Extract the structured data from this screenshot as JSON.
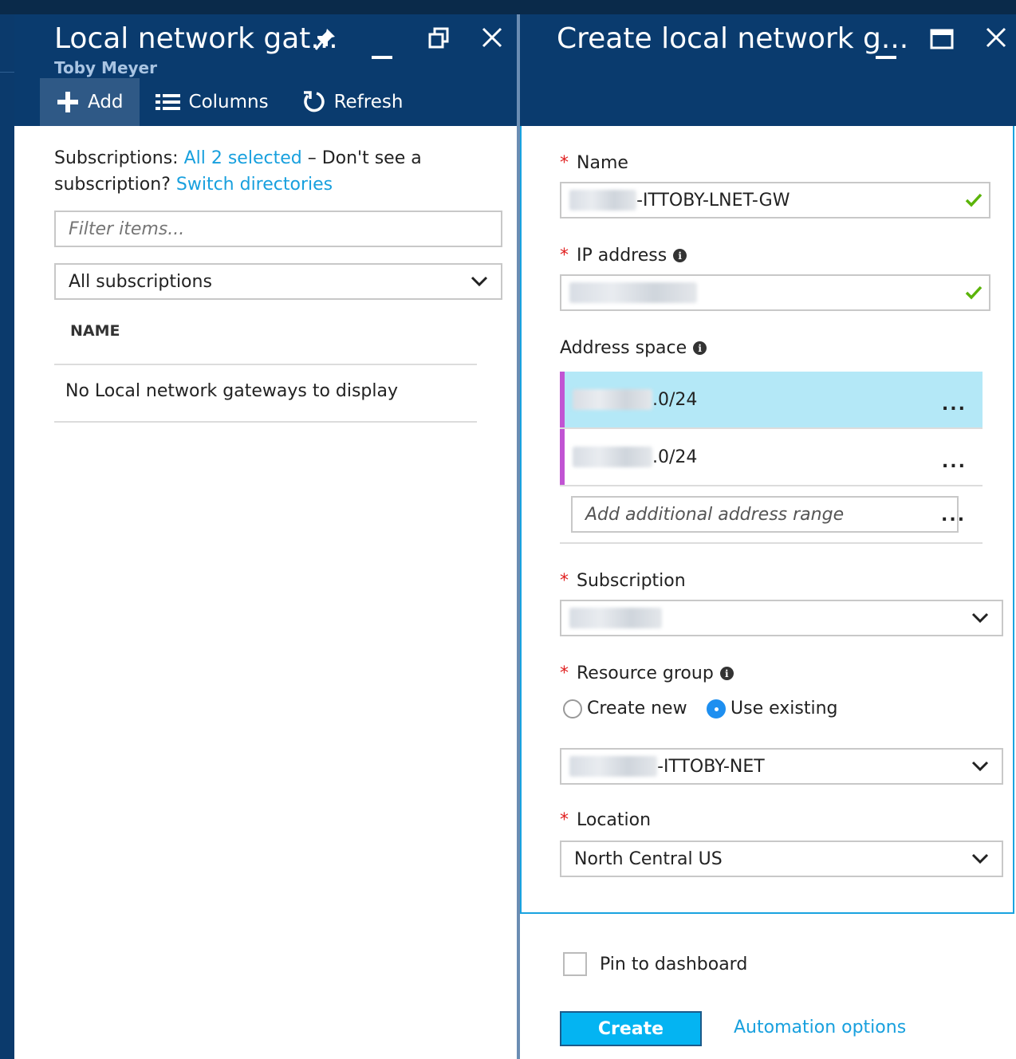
{
  "left_blade": {
    "title": "Local network gat...",
    "subtitle": "Toby Meyer",
    "toolbar": {
      "add": "Add",
      "columns": "Columns",
      "refresh": "Refresh"
    },
    "subscriptions_label": "Subscriptions:",
    "subscriptions_link": "All 2 selected",
    "subscriptions_dash": " – Don't see a subscription? ",
    "switch_link": "Switch directories",
    "filter_placeholder": "Filter items...",
    "subscription_select": "All subscriptions",
    "column_name": "NAME",
    "empty_message": "No Local network gateways to display"
  },
  "right_blade": {
    "title": "Create local network g...",
    "name_label": "Name",
    "name_value_suffix": "-ITTOBY-LNET-GW",
    "ip_label": "IP address",
    "address_space_label": "Address space",
    "address_ranges": [
      {
        "suffix": ".0/24"
      },
      {
        "suffix": ".0/24"
      }
    ],
    "add_range_placeholder": "Add additional address range",
    "subscription_label": "Subscription",
    "resource_group_label": "Resource group",
    "radio_create_new": "Create new",
    "radio_use_existing": "Use existing",
    "resource_group_value_suffix": "-ITTOBY-NET",
    "location_label": "Location",
    "location_value": "North Central US",
    "pin_label": "Pin to dashboard",
    "create_button": "Create",
    "automation_link": "Automation options"
  },
  "icons": {
    "pin": "pin-icon",
    "minimize": "minimize-icon",
    "restore": "restore-icon",
    "maximize": "maximize-icon",
    "close": "close-icon",
    "add": "plus-icon",
    "columns": "columns-icon",
    "refresh": "refresh-icon",
    "check": "check-icon",
    "chevron": "chevron-down-icon",
    "info": "info-icon",
    "more": "more-icon"
  },
  "colors": {
    "header": "#0a3b6e",
    "link": "#18a0de",
    "accent_border": "#19a3e0",
    "selected_row": "#b4e8f7",
    "range_marker": "#c154d3",
    "create_button": "#04b4f2",
    "required": "#e02020",
    "check": "#5bb40a"
  }
}
